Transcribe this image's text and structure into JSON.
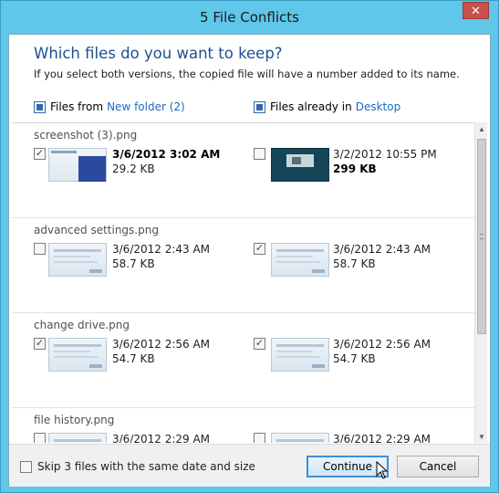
{
  "window": {
    "title": "5 File Conflicts",
    "close_glyph": "✕"
  },
  "header": {
    "question": "Which files do you want to keep?",
    "subtext": "If you select both versions, the copied file will have a number added to its name."
  },
  "columns": {
    "left": {
      "prefix": "Files from",
      "link": "New folder (2)"
    },
    "right": {
      "prefix": "Files already in",
      "link": "Desktop"
    }
  },
  "groups": [
    {
      "name": "screenshot (3).png",
      "left": {
        "checked": true,
        "date": "3/6/2012 3:02 AM",
        "size": "29.2 KB",
        "bold": true
      },
      "right": {
        "checked": false,
        "date": "3/2/2012 10:55 PM",
        "size": "299 KB",
        "bold_size": true
      }
    },
    {
      "name": "advanced settings.png",
      "left": {
        "checked": false,
        "date": "3/6/2012 2:43 AM",
        "size": "58.7 KB"
      },
      "right": {
        "checked": true,
        "date": "3/6/2012 2:43 AM",
        "size": "58.7 KB"
      }
    },
    {
      "name": "change drive.png",
      "left": {
        "checked": true,
        "date": "3/6/2012 2:56 AM",
        "size": "54.7 KB"
      },
      "right": {
        "checked": true,
        "date": "3/6/2012 2:56 AM",
        "size": "54.7 KB"
      }
    },
    {
      "name": "file history.png",
      "left": {
        "checked": false,
        "date": "3/6/2012 2:29 AM",
        "size": ""
      },
      "right": {
        "checked": false,
        "date": "3/6/2012 2:29 AM",
        "size": ""
      }
    }
  ],
  "footer": {
    "skip_label": "Skip 3 files with the same date and size",
    "continue_label": "Continue",
    "cancel_label": "Cancel"
  },
  "colors": {
    "accent": "#1d4f91",
    "link": "#1b6ac2",
    "frame": "#5ec7ea",
    "close": "#c7504a"
  }
}
